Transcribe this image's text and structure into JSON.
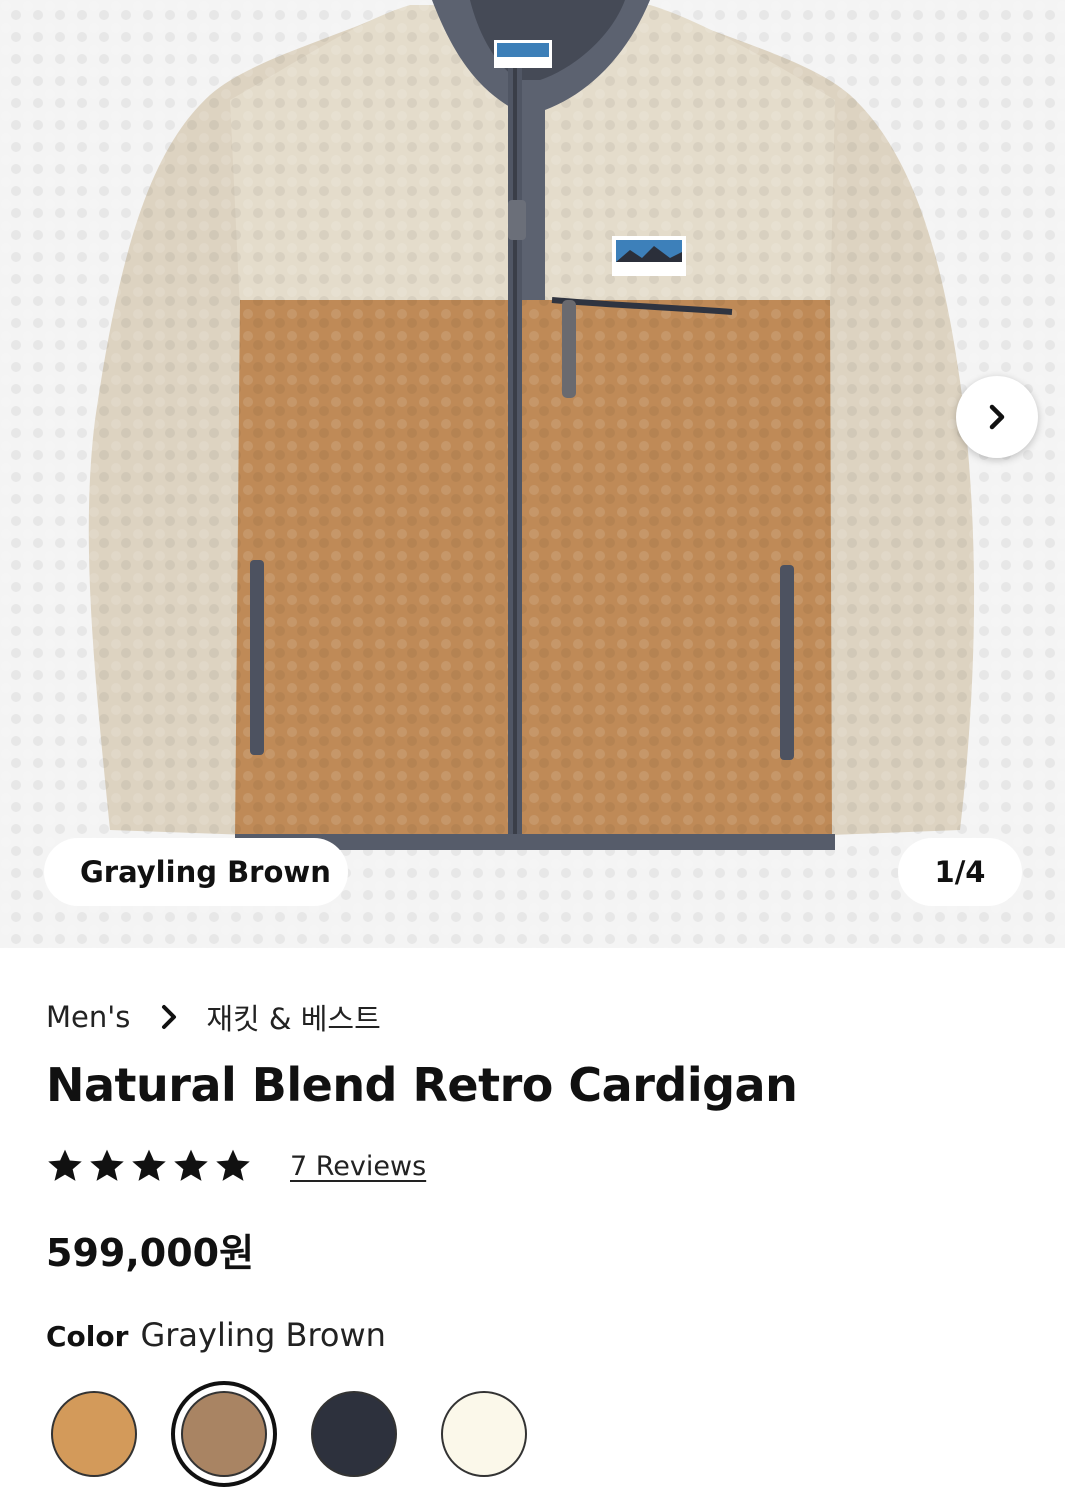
{
  "gallery": {
    "color_pill": "Grayling Brown",
    "counter": "1/4",
    "next_icon": "chevron-right-icon"
  },
  "breadcrumb": {
    "category": "Men's",
    "subcategory": "재킷 & 베스트"
  },
  "product": {
    "title": "Natural Blend Retro Cardigan",
    "rating": 5,
    "rating_max": 5,
    "reviews_label": "7 Reviews",
    "price": "599,000원"
  },
  "color": {
    "label": "Color",
    "selected_name": "Grayling Brown",
    "swatches": [
      {
        "color": "#d39a5a"
      },
      {
        "color": "#a98463",
        "selected": true
      },
      {
        "color": "#2d313d"
      },
      {
        "color": "#fbf8ea"
      }
    ]
  }
}
